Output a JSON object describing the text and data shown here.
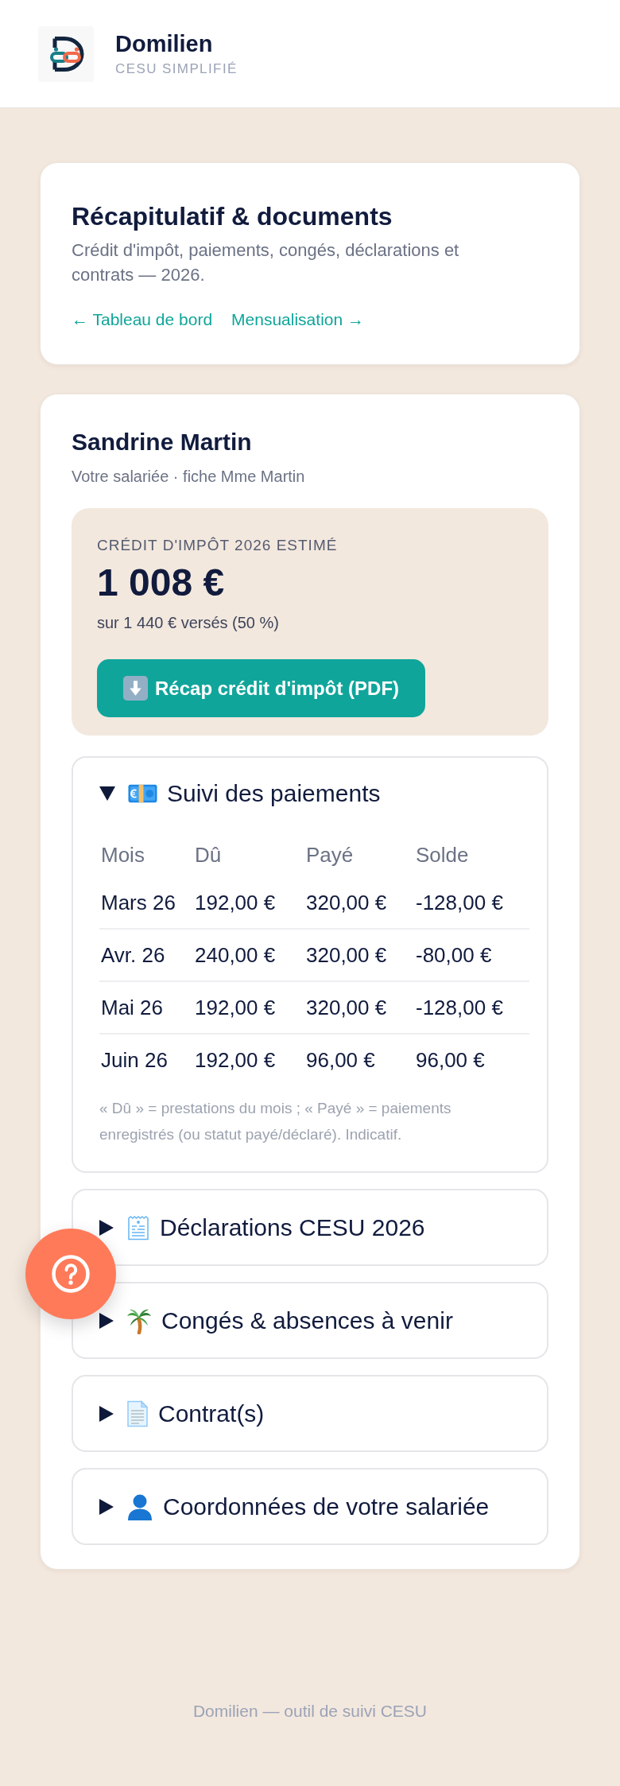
{
  "header": {
    "brand": "Domilien",
    "tagline": "CESU SIMPLIFIÉ"
  },
  "intro": {
    "title": "Récapitulatif & documents",
    "description": "Crédit d'impôt, paiements, congés, déclarations et contrats — 2026.",
    "links": [
      {
        "label": "← Tableau de bord"
      },
      {
        "label": "Mensualisation →"
      }
    ]
  },
  "employee": {
    "name": "Sandrine Martin",
    "subtitle": "Votre salariée · fiche Mme Martin"
  },
  "tax_credit": {
    "label": "CRÉDIT D'IMPÔT 2026 ESTIMÉ",
    "amount": "1 008 €",
    "detail": "sur 1 440 € versés (50 %)",
    "button": "Récap crédit d'impôt (PDF)"
  },
  "sections": [
    {
      "kind": "payments",
      "title": "Suivi des paiements",
      "expanded": true,
      "table": {
        "columns": [
          "Mois",
          "Dû",
          "Payé",
          "Solde"
        ],
        "rows": [
          [
            "Mars 26",
            "192,00 €",
            "320,00 €",
            "-128,00 €"
          ],
          [
            "Avr. 26",
            "240,00 €",
            "320,00 €",
            "-80,00 €"
          ],
          [
            "Mai 26",
            "192,00 €",
            "320,00 €",
            "-128,00 €"
          ],
          [
            "Juin 26",
            "192,00 €",
            "96,00 €",
            "96,00 €"
          ]
        ]
      },
      "note": "« Dû » = prestations du mois ; « Payé » = paiements enregistrés (ou statut payé/déclaré). Indicatif."
    },
    {
      "kind": "declarations",
      "title": "Déclarations CESU 2026",
      "expanded": false
    },
    {
      "kind": "leave",
      "title": "Congés & absences à venir",
      "expanded": false
    },
    {
      "kind": "contracts",
      "title": "Contrat(s)",
      "expanded": false
    },
    {
      "kind": "contact",
      "title": "Coordonnées de votre salariée",
      "expanded": false
    }
  ],
  "footer": "Domilien — outil de suivi CESU"
}
